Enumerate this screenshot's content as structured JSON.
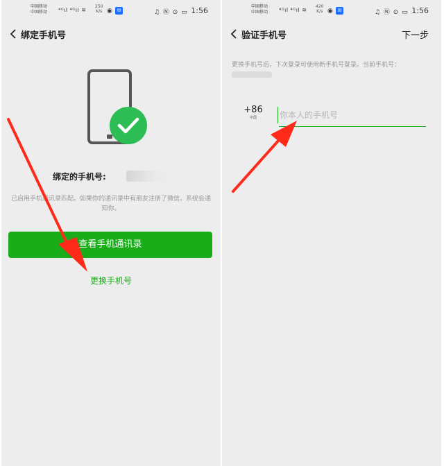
{
  "status_bar": {
    "left": {
      "carrier_1": "中国移动",
      "carrier_2": "中国移动",
      "speed_value": "250",
      "speed_unit": "K/s",
      "time": "1:56"
    },
    "right": {
      "carrier_1": "中国移动",
      "carrier_2": "中国移动",
      "speed_value": "420",
      "speed_unit": "K/s",
      "time": "1:56"
    }
  },
  "left_screen": {
    "title": "绑定手机号",
    "bound_label": "绑定的手机号:",
    "description": "已启用手机通讯录匹配。如果你的通讯录中有朋友注册了微信，系统会通知你。",
    "view_contacts_button": "查看手机通讯录",
    "change_phone_link": "更换手机号"
  },
  "right_screen": {
    "title": "验证手机号",
    "next_label": "下一步",
    "description": "更换手机号后，下次登录可使用新手机号登录。当前手机号：",
    "country_code": "+86",
    "country_name": "中国",
    "phone_placeholder": "你本人的手机号"
  },
  "colors": {
    "accent": "#1aad19",
    "arrow": "#ff2a1a",
    "background": "#ededed"
  }
}
